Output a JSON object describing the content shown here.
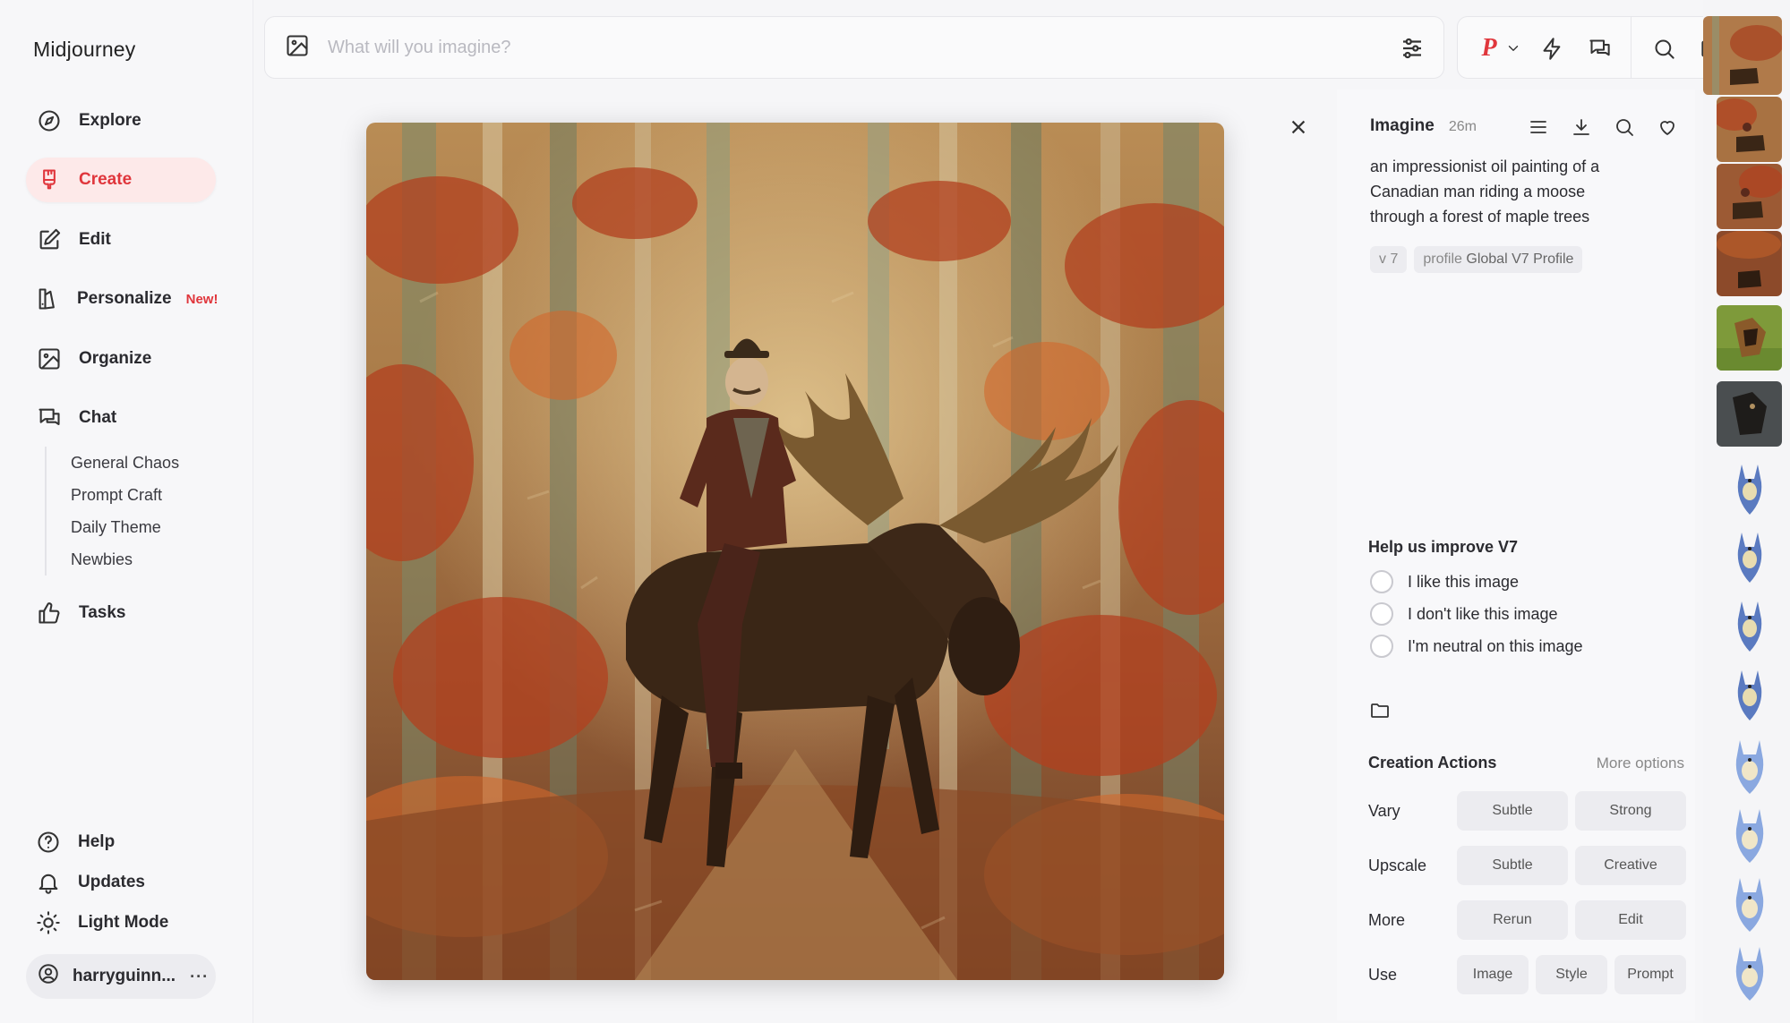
{
  "app": {
    "brand": "Midjourney"
  },
  "sidebar": {
    "items": [
      {
        "label": "Explore",
        "icon": "compass-icon"
      },
      {
        "label": "Create",
        "icon": "brush-icon",
        "active": true
      },
      {
        "label": "Edit",
        "icon": "pencil-square-icon"
      },
      {
        "label": "Personalize",
        "icon": "personalize-icon",
        "badge": "New!"
      },
      {
        "label": "Organize",
        "icon": "image-grid-icon"
      },
      {
        "label": "Chat",
        "icon": "chat-bubbles-icon"
      },
      {
        "label": "Tasks",
        "icon": "thumbs-up-icon"
      }
    ],
    "chat_rooms": [
      "General Chaos",
      "Prompt Craft",
      "Daily Theme",
      "Newbies"
    ],
    "bottom": [
      {
        "label": "Help",
        "icon": "help-circle-icon"
      },
      {
        "label": "Updates",
        "icon": "bell-icon"
      },
      {
        "label": "Light Mode",
        "icon": "sun-icon"
      }
    ],
    "user": {
      "name": "harryguinn...",
      "more": "···"
    }
  },
  "search": {
    "placeholder": "What will you imagine?",
    "value": ""
  },
  "toolbar": {
    "profile_letter": "P"
  },
  "detail": {
    "title": "Imagine",
    "age": "26m",
    "prompt": "an impressionist oil painting of a Canadian man riding a moose through a forest of maple trees",
    "tags": {
      "version": "v 7",
      "profile_prefix": "profile",
      "profile_name": "Global V7 Profile"
    },
    "feedback": {
      "title": "Help us improve V7",
      "options": [
        "I like this image",
        "I don't like this image",
        "I'm neutral on this image"
      ]
    },
    "creation_actions": {
      "title": "Creation Actions",
      "more": "More options",
      "rows": [
        {
          "label": "Vary",
          "buttons": [
            "Subtle",
            "Strong"
          ]
        },
        {
          "label": "Upscale",
          "buttons": [
            "Subtle",
            "Creative"
          ]
        },
        {
          "label": "More",
          "buttons": [
            "Rerun",
            "Edit"
          ]
        },
        {
          "label": "Use",
          "buttons": [
            "Image",
            "Style",
            "Prompt"
          ]
        }
      ]
    }
  },
  "colors": {
    "accent": "#e0363c",
    "active_bg": "#fde9e9",
    "panel_bg": "#f8f8fa"
  }
}
